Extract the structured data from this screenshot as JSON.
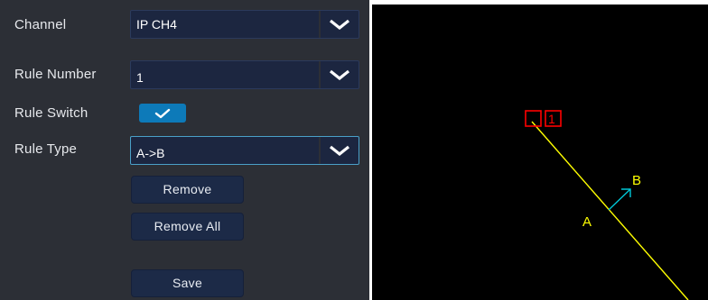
{
  "colors": {
    "panel_bg": "#2c2f36",
    "field_bg": "#1c2640",
    "toggle_on": "#0d7ab9",
    "button_bg": "#1c2a47",
    "line_color": "#ffff00",
    "direction_arrow": "#00c8d8",
    "rule_marker": "#ff0000"
  },
  "settings": {
    "channel": {
      "label": "Channel",
      "value": "IP CH4",
      "icon": "chevron-down-icon"
    },
    "rule_number": {
      "label": "Rule Number",
      "value": "1",
      "icon": "chevron-down-icon"
    },
    "rule_switch": {
      "label": "Rule Switch",
      "enabled": true,
      "icon": "checkmark-icon"
    },
    "rule_type": {
      "label": "Rule Type",
      "value": "A->B",
      "icon": "chevron-down-icon"
    },
    "buttons": {
      "remove": "Remove",
      "remove_all": "Remove All",
      "save": "Save"
    }
  },
  "canvas": {
    "rule_id": "1",
    "side_a": "A",
    "side_b": "B"
  }
}
